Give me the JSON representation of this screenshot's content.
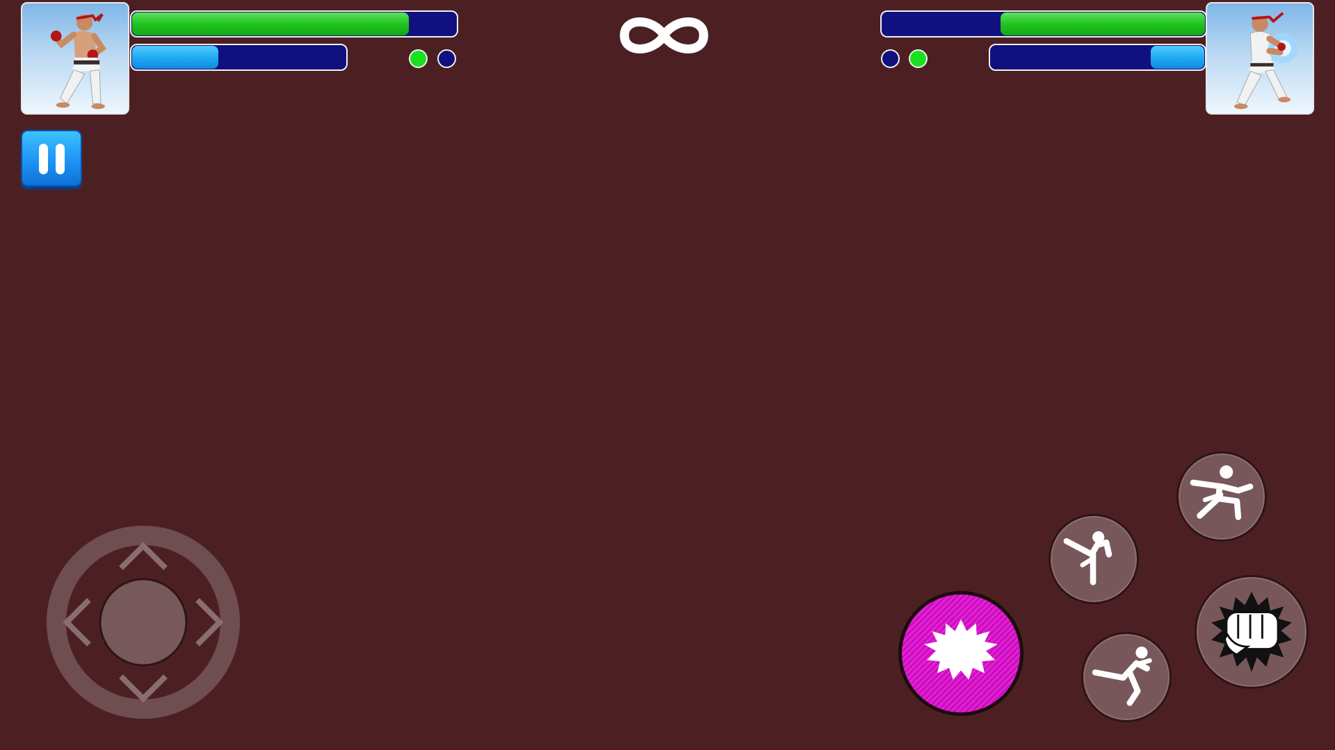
{
  "hud": {
    "timer": {
      "display": "infinity-icon"
    },
    "player1": {
      "portrait": "fighter-portrait-white-gi",
      "health": 0.85,
      "energy": 0.4,
      "rounds_won": [
        true,
        false
      ]
    },
    "player2": {
      "portrait": "fighter-portrait-white-gi-energy",
      "health": 0.63,
      "energy": 0.25,
      "rounds_won": [
        false,
        true
      ]
    }
  },
  "controls": {
    "pause": {
      "icon": "pause-icon"
    },
    "dpad": {
      "icons": [
        "arrow-up-icon",
        "arrow-down-icon",
        "arrow-left-icon",
        "arrow-right-icon"
      ]
    },
    "buttons": [
      {
        "name": "special-attack",
        "icon": "burst-icon"
      },
      {
        "name": "high-kick",
        "icon": "high-kick-icon"
      },
      {
        "name": "low-kick",
        "icon": "flying-kick-icon"
      },
      {
        "name": "dash",
        "icon": "lunge-icon"
      },
      {
        "name": "punch",
        "icon": "fist-icon"
      }
    ]
  },
  "colors": {
    "background": "#4c2023",
    "health": "#21c321",
    "energy": "#1ea8f3",
    "bar_empty": "#10107e",
    "special": "#e91ed9"
  }
}
